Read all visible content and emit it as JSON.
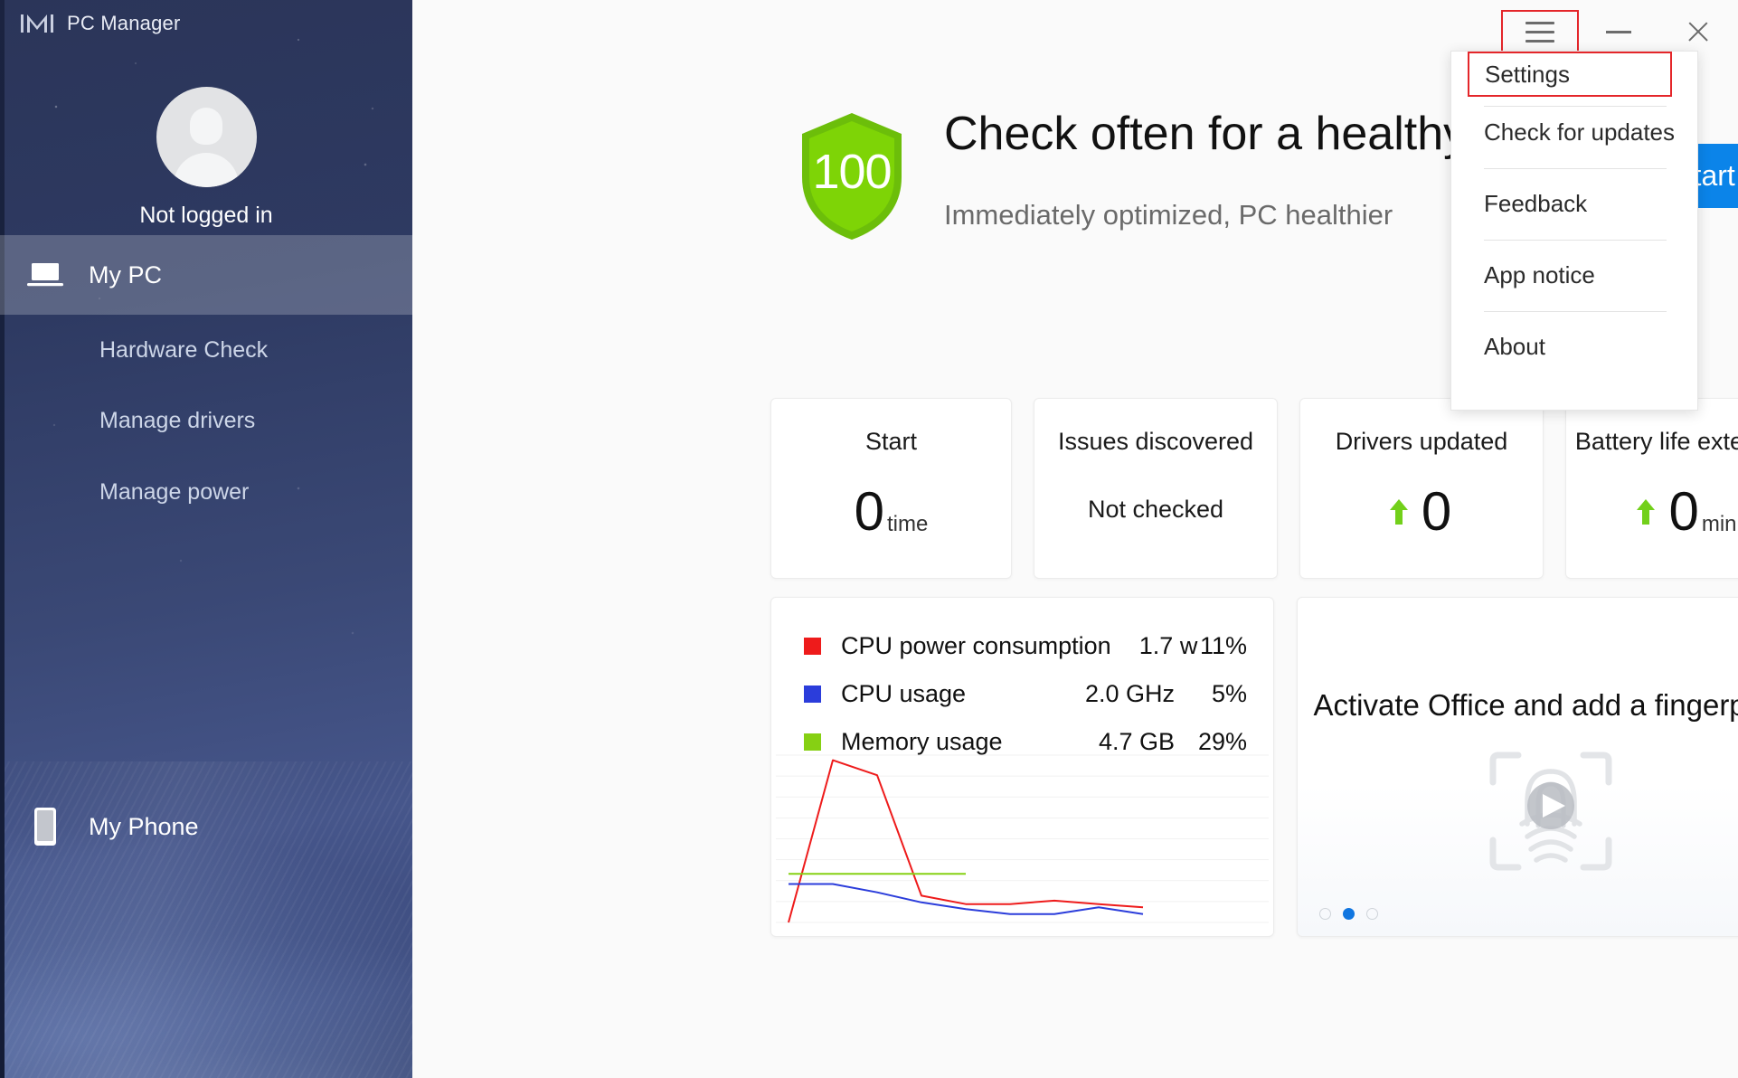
{
  "app": {
    "title": "PC Manager",
    "logo_icon": "pc-manager-logo-icon"
  },
  "titlebar": {
    "menu_button_icon": "hamburger-menu-icon",
    "minimize_icon": "minimize-icon",
    "close_icon": "close-icon"
  },
  "sidebar": {
    "account": {
      "avatar_icon": "user-avatar-icon",
      "status_label": "Not logged in"
    },
    "primary": {
      "label": "My PC",
      "icon": "laptop-icon"
    },
    "items": [
      {
        "label": "Hardware Check"
      },
      {
        "label": "Manage drivers"
      },
      {
        "label": "Manage power"
      }
    ],
    "footer": {
      "label": "My Phone",
      "icon": "phone-icon"
    }
  },
  "hero": {
    "score": "100",
    "score_icon": "shield-icon",
    "title": "Check often for a healthy PC",
    "subtitle": "Immediately optimized, PC healthier",
    "action_label": "Start"
  },
  "stats": [
    {
      "title": "Start",
      "value": "0",
      "unit": "time",
      "has_arrow": false,
      "text": ""
    },
    {
      "title": "Issues discovered",
      "value": "",
      "unit": "",
      "has_arrow": false,
      "text": "Not checked"
    },
    {
      "title": "Drivers updated",
      "value": "0",
      "unit": "",
      "has_arrow": true,
      "text": ""
    },
    {
      "title": "Battery life extended",
      "value": "0",
      "unit": "min",
      "has_arrow": true,
      "text": ""
    }
  ],
  "performance": {
    "rows": [
      {
        "name": "CPU power consumption",
        "value": "1.7 w",
        "percent": "11%",
        "color": "#ee1b1b"
      },
      {
        "name": "CPU usage",
        "value": "2.0 GHz",
        "percent": "5%",
        "color": "#2b3ddb"
      },
      {
        "name": "Memory usage",
        "value": "4.7 GB",
        "percent": "29%",
        "color": "#86d013"
      }
    ]
  },
  "chart_data": {
    "type": "line",
    "title": "",
    "xlabel": "",
    "ylabel": "",
    "ylim": [
      0,
      100
    ],
    "grid": true,
    "legend_position": "top",
    "x": [
      0,
      1,
      2,
      3,
      4,
      5,
      6,
      7,
      8
    ],
    "series": [
      {
        "name": "CPU power consumption",
        "color": "#ee1b1b",
        "values": [
          0,
          97,
          88,
          16,
          11,
          11,
          13,
          11,
          9
        ]
      },
      {
        "name": "CPU usage",
        "color": "#2b3ddb",
        "values": [
          23,
          23,
          18,
          12,
          8,
          5,
          5,
          9,
          5
        ]
      },
      {
        "name": "Memory usage",
        "color": "#86d013",
        "values": [
          29,
          29,
          29,
          29,
          29,
          null,
          null,
          null,
          null
        ]
      }
    ]
  },
  "promo": {
    "headline": "Activate Office and add a fingerprint",
    "art_icon": "fingerprint-scan-play-icon",
    "carousel": {
      "count": 3,
      "active_index": 1
    }
  },
  "menu": {
    "items": [
      {
        "label": "Settings",
        "highlighted": true
      },
      {
        "label": "Check for updates",
        "highlighted": false
      },
      {
        "label": "Feedback",
        "highlighted": false
      },
      {
        "label": "App notice",
        "highlighted": false
      },
      {
        "label": "About",
        "highlighted": false
      }
    ]
  },
  "colors": {
    "accent_blue": "#0b84e9",
    "shield_green": "#72c40b",
    "highlight_red": "#e4262a",
    "sidebar_navy": "#2e3a62"
  }
}
